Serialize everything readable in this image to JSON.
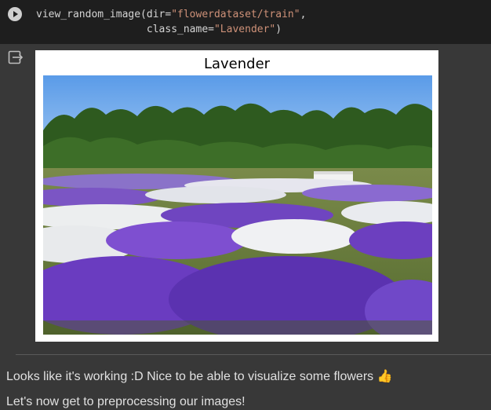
{
  "code_cell": {
    "line1_prefix": "view_random_image(dir=",
    "line1_string": "\"flowerdataset/train\"",
    "line1_suffix": ",",
    "line2_prefix": "class_name=",
    "line2_string": "\"Lavender\"",
    "line2_suffix": ")"
  },
  "output": {
    "figure_title": "Lavender",
    "image_icon": "lavender-field-photo",
    "output_icon": "output-exit-icon"
  },
  "markdown": {
    "line1": "Looks like it's working :D Nice to be able to visualize some flowers 👍",
    "line2": "Let's now get to preprocessing our images!"
  },
  "colors": {
    "background": "#383838",
    "code_background": "#1e1e1e",
    "string_color": "#ce9178"
  }
}
